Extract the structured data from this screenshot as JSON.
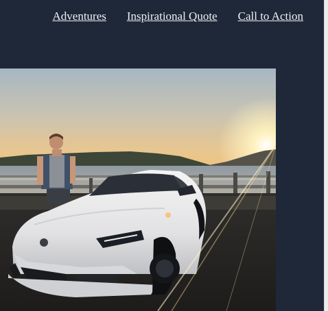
{
  "nav": {
    "items": [
      {
        "label": "Adventures"
      },
      {
        "label": "Inspirational Quote"
      },
      {
        "label": "Call to Action"
      }
    ]
  },
  "colors": {
    "background": "#1f2838",
    "nav_text": "#eef0f4"
  },
  "hero": {
    "description": "photo-person-with-white-sports-car-at-sunset"
  }
}
